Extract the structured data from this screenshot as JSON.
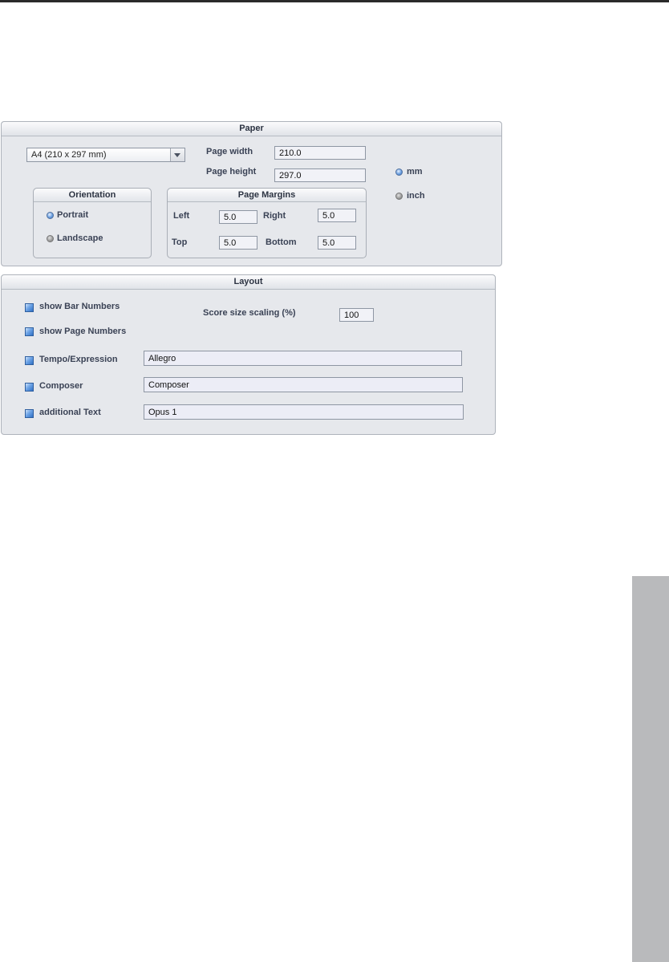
{
  "paper": {
    "title": "Paper",
    "paper_size": "A4 (210 x 297 mm)",
    "page_width_label": "Page width",
    "page_width_value": "210.0",
    "page_height_label": "Page height",
    "page_height_value": "297.0",
    "units": {
      "mm_label": "mm",
      "inch_label": "inch",
      "selected": "mm"
    },
    "orientation": {
      "title": "Orientation",
      "portrait_label": "Portrait",
      "landscape_label": "Landscape",
      "selected": "Portrait"
    },
    "margins": {
      "title": "Page Margins",
      "left_label": "Left",
      "left_value": "5.0",
      "right_label": "Right",
      "right_value": "5.0",
      "top_label": "Top",
      "top_value": "5.0",
      "bottom_label": "Bottom",
      "bottom_value": "5.0"
    }
  },
  "layout": {
    "title": "Layout",
    "show_bar_numbers_label": "show Bar Numbers",
    "show_bar_numbers_checked": true,
    "show_page_numbers_label": "show Page Numbers",
    "show_page_numbers_checked": true,
    "score_scaling_label": "Score size scaling (%)",
    "score_scaling_value": "100",
    "tempo_label": "Tempo/Expression",
    "tempo_checked": true,
    "tempo_value": "Allegro",
    "composer_label": "Composer",
    "composer_checked": true,
    "composer_value": "Composer",
    "additional_text_label": "additional Text",
    "additional_text_checked": true,
    "additional_text_value": "Opus 1"
  },
  "colors": {
    "panel_background": "#e6e8ec",
    "checkbox_blue": "#2f6fc4",
    "side_tab_gray": "#b9babc"
  }
}
